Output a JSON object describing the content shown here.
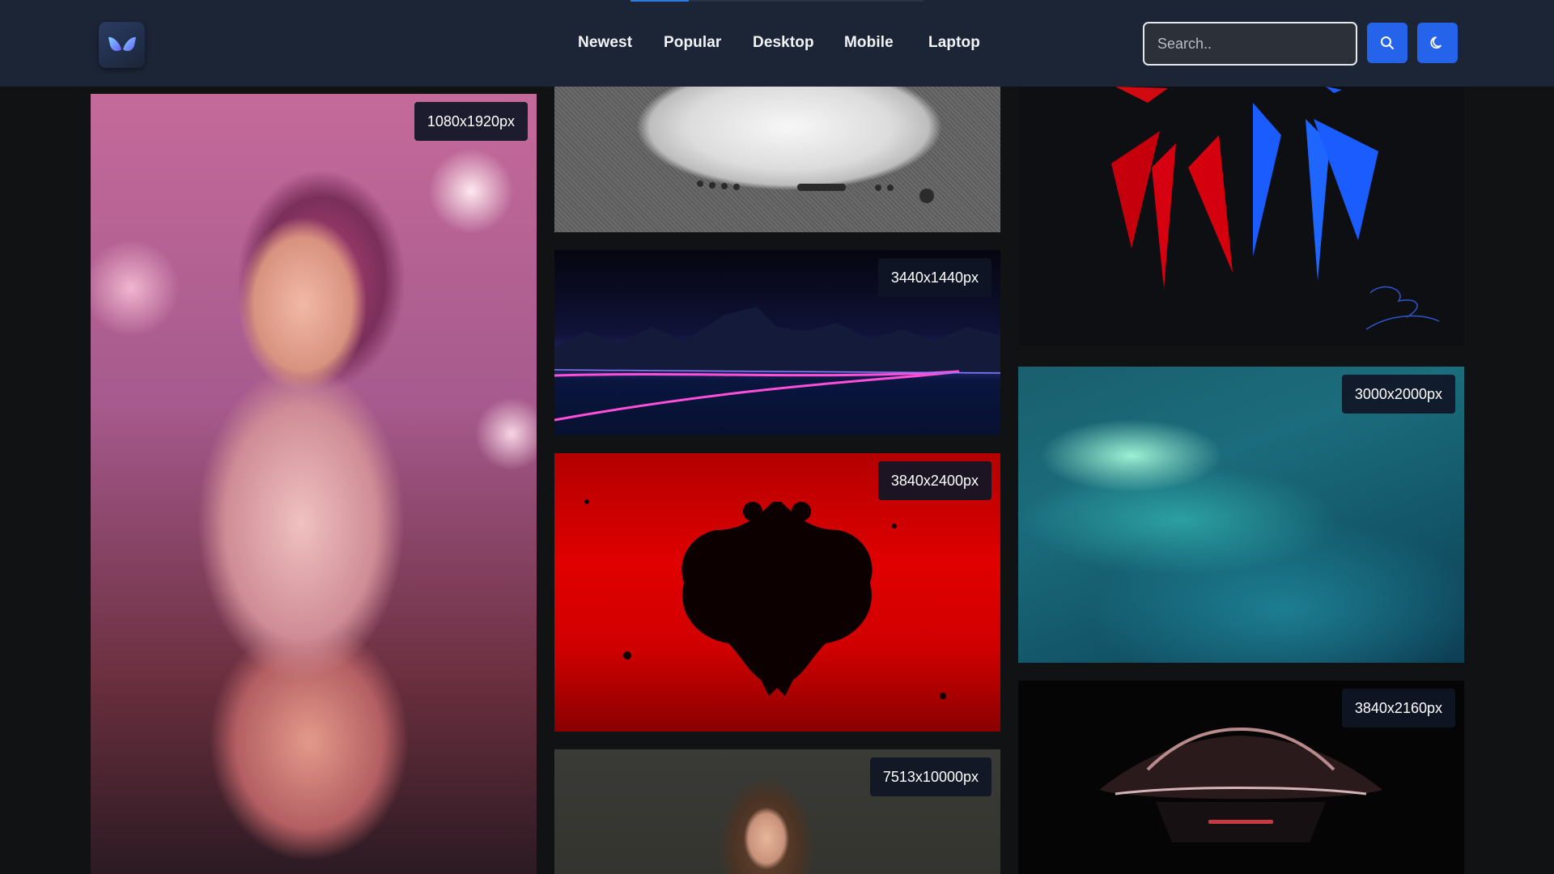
{
  "header": {
    "logo_alt": "butterfly logo",
    "progress_fraction": 0.2,
    "nav": [
      {
        "label": "Newest"
      },
      {
        "label": "Popular"
      },
      {
        "label": "Desktop"
      },
      {
        "label": "Mobile"
      },
      {
        "label": "Laptop"
      }
    ],
    "search": {
      "placeholder": "Search..",
      "value": ""
    },
    "search_icon": "search-icon",
    "theme_icon": "moon-icon"
  },
  "gallery": {
    "cards": [
      {
        "resolution": "1080x1920px",
        "subject": "character-portrait"
      },
      {
        "resolution": "",
        "subject": "white-phone"
      },
      {
        "resolution": "3440x1440px",
        "subject": "synthwave-mountains"
      },
      {
        "resolution": "3840x2400px",
        "subject": "albanian-flag"
      },
      {
        "resolution": "7513x10000px",
        "subject": "woman-portrait"
      },
      {
        "resolution": "",
        "subject": "red-blue-spikes"
      },
      {
        "resolution": "3000x2000px",
        "subject": "aurora"
      },
      {
        "resolution": "3840x2160px",
        "subject": "supercar"
      }
    ]
  },
  "colors": {
    "accent": "#2563eb",
    "header_bg": "#1c2536",
    "page_bg": "#111214"
  }
}
